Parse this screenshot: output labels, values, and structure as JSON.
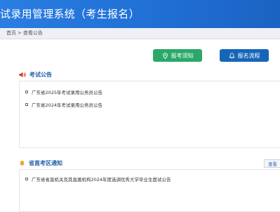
{
  "header": {
    "title": "试录用管理系统（考生报名）",
    "bg": "#1f6fd6"
  },
  "breadcrumb": {
    "home": "首页",
    "sep": ">",
    "current": "查看公告"
  },
  "actions": {
    "guide": {
      "label": "报考须知",
      "icon": "location-pin-icon",
      "color": "#2aa869"
    },
    "process": {
      "label": "报名流程",
      "icon": "bell-icon",
      "color": "#1666b8"
    }
  },
  "exam_notices": {
    "title": "考试公告",
    "icon": "speaker-icon",
    "items": [
      "广东省2025年考试录用公务员公告",
      "广东省2024年考试录用公务员公告"
    ]
  },
  "district_notices": {
    "title": "省直考区通知",
    "icon": "bell-icon",
    "more_label": "查看",
    "items": [
      "广东省省直机关及其直属机构2024年度选调优秀大学毕业生面试公告"
    ]
  }
}
